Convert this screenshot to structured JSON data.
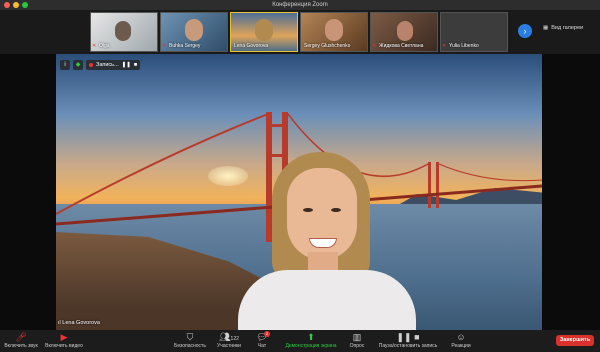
{
  "window": {
    "title": "Конференция Zoom"
  },
  "gallery": {
    "participants": [
      {
        "name": "Olga",
        "bg": "#d7d7d7"
      },
      {
        "name": "Buhka Sergey",
        "bg": "#4e7fa8"
      },
      {
        "name": "Lena Govorova",
        "bg": "#d8a25c"
      },
      {
        "name": "Sergey Glushchenko",
        "bg": "#9a6a42"
      },
      {
        "name": "Жидкова Светлана",
        "bg": "#6d4a3a"
      },
      {
        "name": "Yulia Libenko",
        "bg": "#3a3a3a"
      }
    ],
    "view_toggle_label": "Вид галереи"
  },
  "recording": {
    "label": "Запись..."
  },
  "speaker": {
    "name": "Lena Govorova"
  },
  "toolbar": {
    "mute_label": "Включить звук",
    "video_label": "Включить видео",
    "security_label": "Безопасность",
    "participants_label": "Участники",
    "participants_count": "122",
    "chat_label": "Чат",
    "chat_badge": "2",
    "share_label": "Демонстрация экрана",
    "polls_label": "Опрос",
    "record_label": "Пауза/остановить запись",
    "reactions_label": "Реакции",
    "end_label": "Завершить"
  },
  "colors": {
    "accent": "#2a7de1",
    "end": "#d9312b",
    "share": "#2ecc40",
    "active_border": "#e6c32f"
  }
}
